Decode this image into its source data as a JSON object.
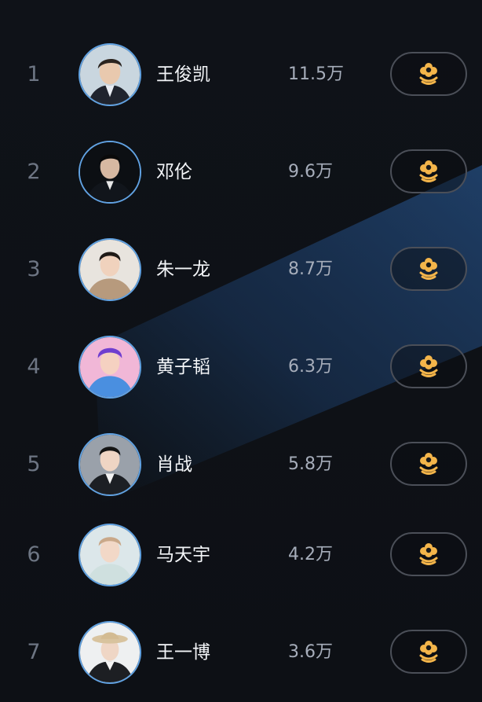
{
  "accent_colors": {
    "avatar_ring": "#61a2e2",
    "flower_icon": "#f4b54a",
    "name_text": "#f3f5f8",
    "score_text": "#a6adba",
    "rank_text": "#6d7583"
  },
  "ranking": [
    {
      "rank": "1",
      "name": "王俊凯",
      "score": "11.5万",
      "icon": "flower-icon"
    },
    {
      "rank": "2",
      "name": "邓伦",
      "score": "9.6万",
      "icon": "flower-icon"
    },
    {
      "rank": "3",
      "name": "朱一龙",
      "score": "8.7万",
      "icon": "flower-icon"
    },
    {
      "rank": "4",
      "name": "黄子韬",
      "score": "6.3万",
      "icon": "flower-icon"
    },
    {
      "rank": "5",
      "name": "肖战",
      "score": "5.8万",
      "icon": "flower-icon"
    },
    {
      "rank": "6",
      "name": "马天宇",
      "score": "4.2万",
      "icon": "flower-icon"
    },
    {
      "rank": "7",
      "name": "王一博",
      "score": "3.6万",
      "icon": "flower-icon"
    }
  ]
}
